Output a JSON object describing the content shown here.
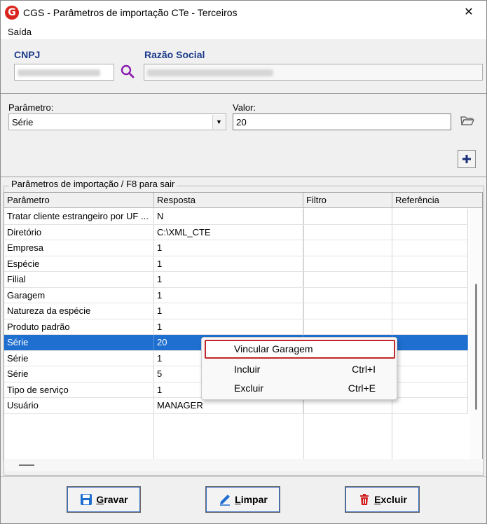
{
  "window": {
    "title": "CGS - Parâmetros de importação CTe - Terceiros",
    "close_glyph": "✕"
  },
  "menu": {
    "items": [
      "Saída"
    ]
  },
  "header": {
    "cnpj_label": "CNPJ",
    "razao_label": "Razão Social"
  },
  "form": {
    "parametro_label": "Parâmetro:",
    "parametro_value": "Série",
    "valor_label": "Valor:",
    "valor_value": "20"
  },
  "group": {
    "title": "Parâmetros de importação / F8 para sair"
  },
  "grid": {
    "columns": [
      "Parâmetro",
      "Resposta",
      "Filtro",
      "Referência"
    ],
    "rows": [
      {
        "param": "Tratar cliente estrangeiro por UF ...",
        "resp": "N"
      },
      {
        "param": "Diretório",
        "resp": "C:\\XML_CTE"
      },
      {
        "param": "Empresa",
        "resp": "1"
      },
      {
        "param": "Espécie",
        "resp": "1"
      },
      {
        "param": "Filial",
        "resp": "1"
      },
      {
        "param": "Garagem",
        "resp": "1"
      },
      {
        "param": "Natureza da espécie",
        "resp": "1"
      },
      {
        "param": "Produto padrão",
        "resp": "1"
      },
      {
        "param": "Série",
        "resp": "20"
      },
      {
        "param": "Série",
        "resp": "1"
      },
      {
        "param": "Série",
        "resp": "5"
      },
      {
        "param": "Tipo de serviço",
        "resp": "1"
      },
      {
        "param": "Usuário",
        "resp": "MANAGER"
      }
    ],
    "selected_index": 8
  },
  "context_menu": {
    "items": [
      {
        "label": "Vincular Garagem",
        "shortcut": ""
      },
      {
        "label": "Incluir",
        "shortcut": "Ctrl+I"
      },
      {
        "label": "Excluir",
        "shortcut": "Ctrl+E"
      }
    ]
  },
  "buttons": {
    "gravar_first": "G",
    "gravar_rest": "ravar",
    "limpar_first": "L",
    "limpar_rest": "impar",
    "excluir_first": "E",
    "excluir_rest": "xcluir"
  },
  "colors": {
    "accent": "#1a3a8a",
    "selection": "#1f6fd0",
    "danger": "#c0282a"
  }
}
